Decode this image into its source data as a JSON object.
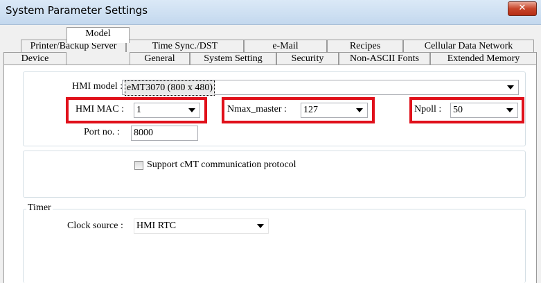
{
  "window": {
    "title": "System Parameter Settings",
    "close_label": "✕"
  },
  "tabs_row1": [
    {
      "label": "Printer/Backup Server"
    },
    {
      "label": "Time Sync./DST"
    },
    {
      "label": "e-Mail"
    },
    {
      "label": "Recipes"
    },
    {
      "label": "Cellular Data Network"
    }
  ],
  "tabs_row2": [
    {
      "label": "Device"
    },
    {
      "label": "Model",
      "active": true
    },
    {
      "label": "General"
    },
    {
      "label": "System Setting"
    },
    {
      "label": "Security"
    },
    {
      "label": "Non-ASCII Fonts"
    },
    {
      "label": "Extended Memory"
    }
  ],
  "model": {
    "hmi_model_label": "HMI model :",
    "hmi_model_value": "eMT3070 (800 x 480)",
    "hmi_mac_label": "HMI MAC :",
    "hmi_mac_value": "1",
    "nmax_label": "Nmax_master :",
    "nmax_value": "127",
    "npoll_label": "Npoll :",
    "npoll_value": "50",
    "port_label": "Port no. :",
    "port_value": "8000"
  },
  "cmt": {
    "label": "Support cMT communication protocol",
    "checked": false
  },
  "timer": {
    "legend": "Timer",
    "clock_label": "Clock source :",
    "clock_value": "HMI RTC"
  },
  "colors": {
    "highlight": "#e0101a",
    "close": "#c7452b"
  }
}
